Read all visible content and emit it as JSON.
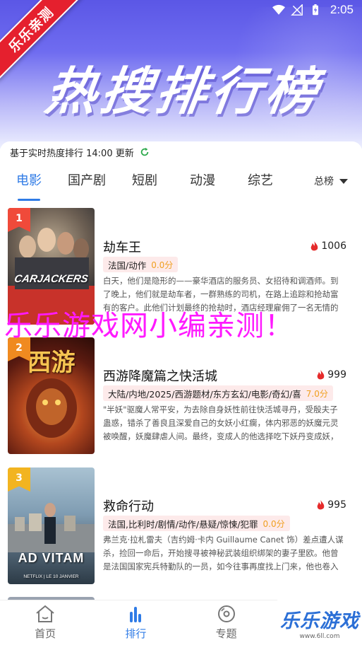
{
  "status_bar": {
    "time": "2:05"
  },
  "banner": {
    "ribbon": "乐乐亲测",
    "title": "热搜排行榜"
  },
  "update_info": "基于实时热度排行 14:00 更新",
  "tabs": [
    {
      "label": "电影",
      "active": true
    },
    {
      "label": "国产剧",
      "active": false
    },
    {
      "label": "短剧",
      "active": false
    },
    {
      "label": "动漫",
      "active": false
    },
    {
      "label": "综艺",
      "active": false
    }
  ],
  "sort": {
    "label": "总榜"
  },
  "items": [
    {
      "rank": "1",
      "rank_color": "#f04a3a",
      "poster_text": "CARJACKERS",
      "title": "劫车王",
      "hot": "1006",
      "tags": "法国/动作",
      "score": "0.0分",
      "desc": "白天，他们是隐形的——豪华酒店的服务员、女招待和调酒师。到了晚上，他们就是劫车者，一群熟练的司机，在路上追踪和抢劫富有的客户。此他们计划最终的抢劫时，酒店经理雇佣了一名无情的杀手..."
    },
    {
      "rank": "2",
      "rank_color": "#f08a20",
      "poster_text": "西游",
      "title": "西游降魔篇之快活城",
      "hot": "999",
      "tags": "大陆/内地/2025/西游题材/东方玄幻/电影/奇幻/喜",
      "score": "7.0分",
      "desc": "\"半妖\"驱魔人常平安，为去除自身妖性前往快活城寻丹，受殷夫子蛊惑，错杀了善良且深爱自己的女妖小红瘸，体内邪恶的妖魔元灵被唤醒，妖魔肆虐人间。最终，变成人的他选择吃下妖丹变成妖，携手..."
    },
    {
      "rank": "3",
      "rank_color": "#f2b420",
      "poster_text": "AD VITAM",
      "poster_sub": "NETFLIX | LE 10 JANVIER",
      "title": "救命行动",
      "hot": "995",
      "tags": "法国,比利时/剧情/动作/悬疑/惊悚/犯罪",
      "score": "0.0分",
      "desc": "弗兰克·拉札雷夫（吉约姆·卡内 Guillaume Canet 饰）差点遭人谋杀，捡回一命后，开始搜寻被神秘武装组织绑架的妻子里欧。他曾是法国国家宪兵特勤队的一员，如今往事再度找上门来，他也卷入事..."
    }
  ],
  "watermark": "乐乐游戏网小编亲测！",
  "bottom_nav": [
    {
      "label": "首页",
      "active": false
    },
    {
      "label": "排行",
      "active": true
    },
    {
      "label": "专题",
      "active": false
    }
  ],
  "logo": {
    "text": "乐乐游戏",
    "url": "www.6ll.com"
  },
  "colors": {
    "accent": "#2f7be6",
    "hot": "#e52b2b",
    "watermark": "#ff1aff"
  }
}
